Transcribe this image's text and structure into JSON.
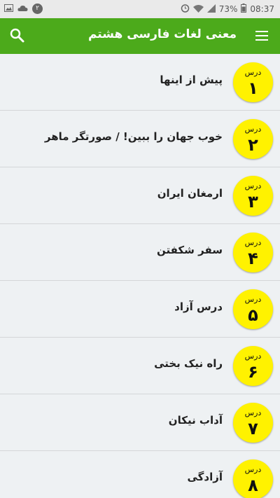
{
  "status_bar": {
    "notification_count": "۲",
    "battery": "73%",
    "time": "08:37",
    "icons": [
      "image-icon",
      "cloud-icon",
      "alarm-icon",
      "wifi-icon",
      "signal-icon",
      "battery-icon"
    ]
  },
  "app_bar": {
    "title": "معنی لغات فارسی هشتم",
    "menu_icon": "hamburger-menu-icon",
    "search_icon": "search-icon",
    "color": "#4caa1b"
  },
  "lessons": [
    {
      "dars": "درس",
      "number": "۱",
      "title": "پیش از اینها"
    },
    {
      "dars": "درس",
      "number": "۲",
      "title": "خوب جهان را ببین! / صورتگر ماهر"
    },
    {
      "dars": "درس",
      "number": "۳",
      "title": "ارمغان ایران"
    },
    {
      "dars": "درس",
      "number": "۴",
      "title": "سفر شکفتن"
    },
    {
      "dars": "درس",
      "number": "۵",
      "title": "درس آزاد"
    },
    {
      "dars": "درس",
      "number": "۶",
      "title": "راه نیک بختی"
    },
    {
      "dars": "درس",
      "number": "۷",
      "title": "آداب نیکان"
    },
    {
      "dars": "درس",
      "number": "۸",
      "title": "آزادگی"
    }
  ],
  "colors": {
    "badge": "#fff200",
    "background": "#eef1f3"
  }
}
